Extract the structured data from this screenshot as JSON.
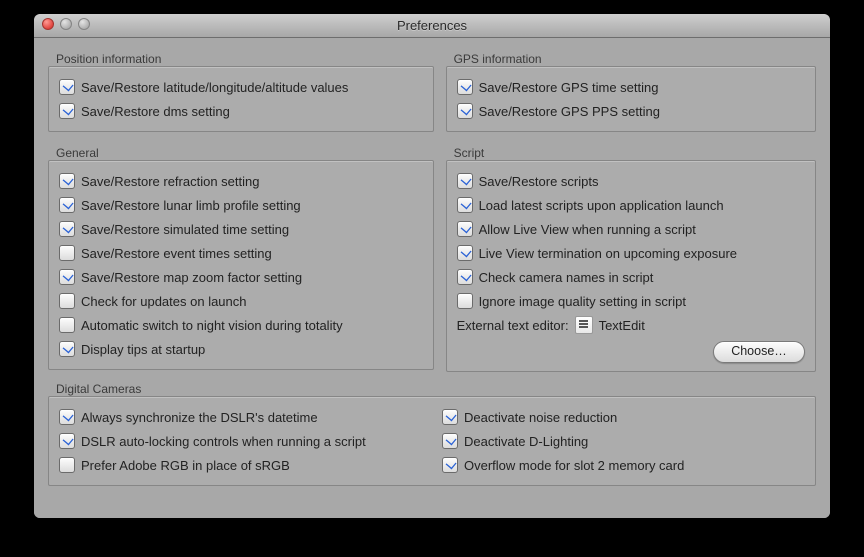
{
  "window": {
    "title": "Preferences"
  },
  "positionInfo": {
    "title": "Position information",
    "items": [
      {
        "label": "Save/Restore latitude/longitude/altitude values",
        "checked": true
      },
      {
        "label": "Save/Restore dms setting",
        "checked": true
      }
    ]
  },
  "gpsInfo": {
    "title": "GPS information",
    "items": [
      {
        "label": "Save/Restore GPS time setting",
        "checked": true
      },
      {
        "label": "Save/Restore GPS PPS setting",
        "checked": true
      }
    ]
  },
  "general": {
    "title": "General",
    "items": [
      {
        "label": "Save/Restore refraction setting",
        "checked": true
      },
      {
        "label": "Save/Restore lunar limb profile setting",
        "checked": true
      },
      {
        "label": "Save/Restore simulated time setting",
        "checked": true
      },
      {
        "label": "Save/Restore event times setting",
        "checked": false
      },
      {
        "label": "Save/Restore map zoom factor setting",
        "checked": true
      },
      {
        "label": "Check for updates on launch",
        "checked": false
      },
      {
        "label": "Automatic switch to night vision during totality",
        "checked": false
      },
      {
        "label": "Display tips at startup",
        "checked": true
      }
    ]
  },
  "script": {
    "title": "Script",
    "items": [
      {
        "label": "Save/Restore scripts",
        "checked": true
      },
      {
        "label": "Load latest scripts upon application launch",
        "checked": true
      },
      {
        "label": "Allow Live View when running a script",
        "checked": true
      },
      {
        "label": "Live View termination on upcoming exposure",
        "checked": true
      },
      {
        "label": "Check camera names in script",
        "checked": true
      },
      {
        "label": "Ignore image quality setting in script",
        "checked": false
      }
    ],
    "externalLabel": "External text editor:",
    "externalApp": "TextEdit",
    "chooseLabel": "Choose…"
  },
  "digitalCameras": {
    "title": "Digital Cameras",
    "left": [
      {
        "label": "Always synchronize the DSLR's datetime",
        "checked": true
      },
      {
        "label": "DSLR auto-locking controls when running a script",
        "checked": true
      },
      {
        "label": "Prefer Adobe RGB in place of sRGB",
        "checked": false
      }
    ],
    "right": [
      {
        "label": "Deactivate noise reduction",
        "checked": true
      },
      {
        "label": "Deactivate D-Lighting",
        "checked": true
      },
      {
        "label": "Overflow mode for slot 2 memory card",
        "checked": true
      }
    ]
  }
}
